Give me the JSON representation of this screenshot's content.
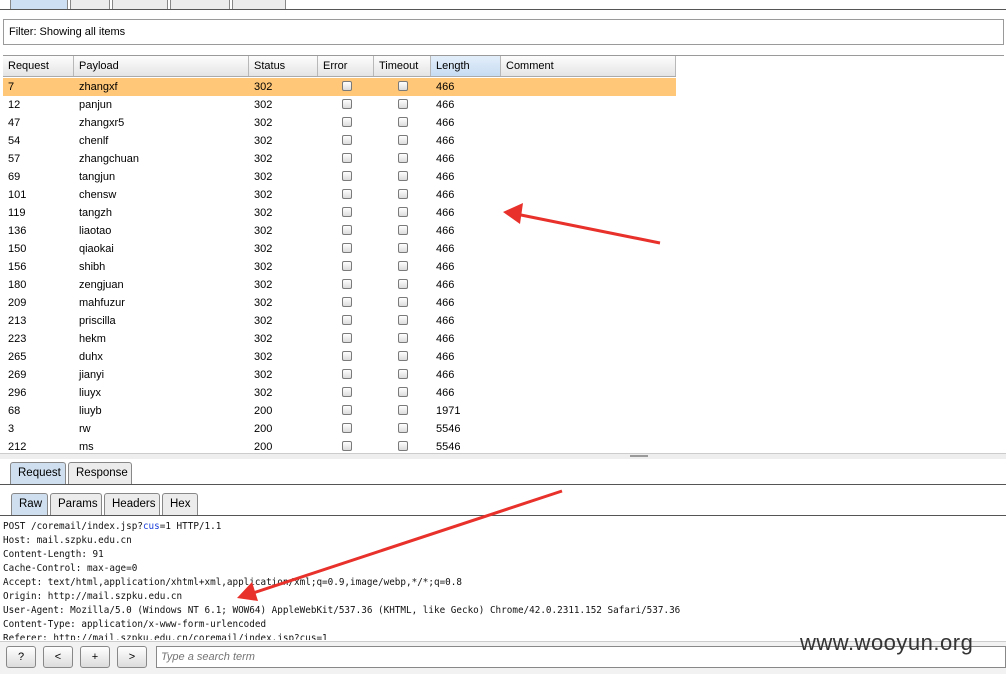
{
  "filter": {
    "text": "Filter:  Showing all items"
  },
  "results": {
    "columns": [
      "Request",
      "Payload",
      "Status",
      "Error",
      "Timeout",
      "Length",
      "Comment"
    ],
    "sort_arrow": "▲",
    "rows": [
      {
        "request": "7",
        "payload": "zhangxf",
        "status": "302",
        "length": "466",
        "selected": true
      },
      {
        "request": "12",
        "payload": "panjun",
        "status": "302",
        "length": "466"
      },
      {
        "request": "47",
        "payload": "zhangxr5",
        "status": "302",
        "length": "466"
      },
      {
        "request": "54",
        "payload": "chenlf",
        "status": "302",
        "length": "466"
      },
      {
        "request": "57",
        "payload": "zhangchuan",
        "status": "302",
        "length": "466"
      },
      {
        "request": "69",
        "payload": "tangjun",
        "status": "302",
        "length": "466"
      },
      {
        "request": "101",
        "payload": "chensw",
        "status": "302",
        "length": "466"
      },
      {
        "request": "119",
        "payload": "tangzh",
        "status": "302",
        "length": "466"
      },
      {
        "request": "136",
        "payload": "liaotao",
        "status": "302",
        "length": "466"
      },
      {
        "request": "150",
        "payload": "qiaokai",
        "status": "302",
        "length": "466"
      },
      {
        "request": "156",
        "payload": "shibh",
        "status": "302",
        "length": "466"
      },
      {
        "request": "180",
        "payload": "zengjuan",
        "status": "302",
        "length": "466"
      },
      {
        "request": "209",
        "payload": "mahfuzur",
        "status": "302",
        "length": "466"
      },
      {
        "request": "213",
        "payload": "priscilla",
        "status": "302",
        "length": "466"
      },
      {
        "request": "223",
        "payload": "hekm",
        "status": "302",
        "length": "466"
      },
      {
        "request": "265",
        "payload": "duhx",
        "status": "302",
        "length": "466"
      },
      {
        "request": "269",
        "payload": "jianyi",
        "status": "302",
        "length": "466"
      },
      {
        "request": "296",
        "payload": "liuyx",
        "status": "302",
        "length": "466"
      },
      {
        "request": "68",
        "payload": "liuyb",
        "status": "200",
        "length": "1971"
      },
      {
        "request": "3",
        "payload": "rw",
        "status": "200",
        "length": "5546"
      },
      {
        "request": "212",
        "payload": "ms",
        "status": "200",
        "length": "5546"
      }
    ]
  },
  "message_tabs": [
    "Request",
    "Response"
  ],
  "view_tabs": [
    "Raw",
    "Params",
    "Headers",
    "Hex"
  ],
  "raw_request": {
    "line1_pre": "POST /coremail/index.jsp?",
    "line1_kw": "cus",
    "line1_post": "=1 HTTP/1.1",
    "lines": [
      "Host: mail.szpku.edu.cn",
      "Content-Length: 91",
      "Cache-Control: max-age=0",
      "Accept: text/html,application/xhtml+xml,application/xml;q=0.9,image/webp,*/*;q=0.8",
      "Origin: http://mail.szpku.edu.cn",
      "User-Agent: Mozilla/5.0 (Windows NT 6.1; WOW64) AppleWebKit/537.36 (KHTML, like Gecko) Chrome/42.0.2311.152 Safari/537.36",
      "Content-Type: application/x-www-form-urlencoded",
      "Referer: http://mail.szpku.edu.cn/coremail/index.jsp?cus=1"
    ]
  },
  "bottom_bar": {
    "help_label": "?",
    "prev_label": "<",
    "add_label": "+",
    "next_label": ">",
    "search_placeholder": "Type a search term"
  },
  "watermark": "www.wooyun.org",
  "colors": {
    "selected_row": "#ffc777",
    "annotation_arrow": "#e8312b"
  }
}
